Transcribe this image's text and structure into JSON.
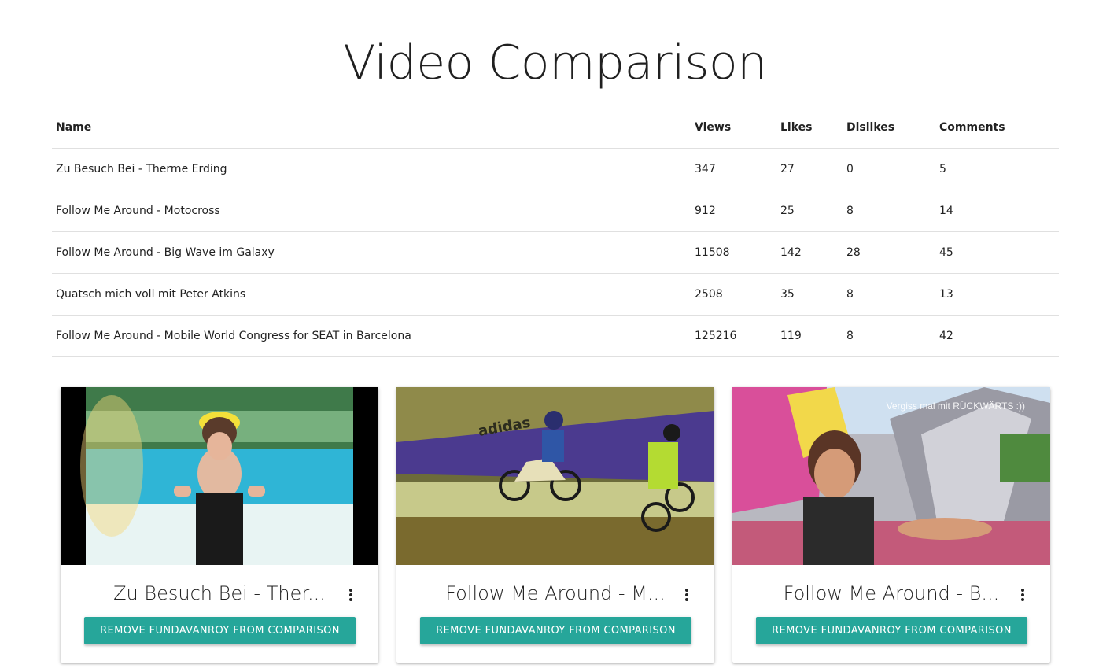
{
  "page": {
    "title": "Video Comparison"
  },
  "table": {
    "headers": {
      "name": "Name",
      "views": "Views",
      "likes": "Likes",
      "dislikes": "Dislikes",
      "comments": "Comments"
    },
    "rows": [
      {
        "name": "Zu Besuch Bei - Therme Erding",
        "views": "347",
        "likes": "27",
        "dislikes": "0",
        "comments": "5"
      },
      {
        "name": "Follow Me Around - Motocross",
        "views": "912",
        "likes": "25",
        "dislikes": "8",
        "comments": "14"
      },
      {
        "name": "Follow Me Around - Big Wave im Galaxy",
        "views": "11508",
        "likes": "142",
        "dislikes": "28",
        "comments": "45"
      },
      {
        "name": "Quatsch mich voll mit Peter Atkins",
        "views": "2508",
        "likes": "35",
        "dislikes": "8",
        "comments": "13"
      },
      {
        "name": "Follow Me Around - Mobile World Congress for SEAT in Barcelona",
        "views": "125216",
        "likes": "119",
        "dislikes": "8",
        "comments": "42"
      }
    ]
  },
  "cards": [
    {
      "title": "Zu Besuch Bei - Ther...",
      "button": "REMOVE FUNDAVANROY FROM COMPARISON",
      "thumb_overlay": ""
    },
    {
      "title": "Follow Me Around - M...",
      "button": "REMOVE FUNDAVANROY FROM COMPARISON",
      "thumb_overlay": "adidas"
    },
    {
      "title": "Follow Me Around - B...",
      "button": "REMOVE FUNDAVANROY FROM COMPARISON",
      "thumb_overlay": "Vergiss mal mit RÜCKWÄRTS :))"
    }
  ],
  "colors": {
    "accent": "#26a69a"
  }
}
